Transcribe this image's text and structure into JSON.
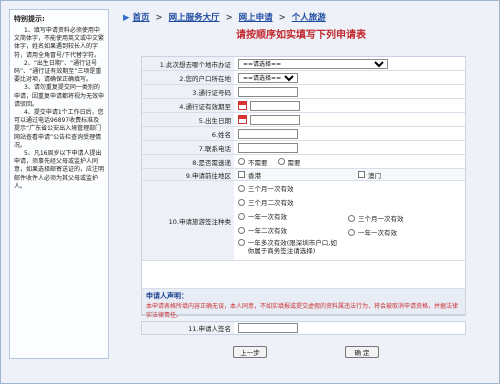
{
  "sidebar": {
    "title": "特别提示:",
    "paragraphs": [
      "1、填写申请资料必须使用中文简体字，不能使用英文或中文繁体字，姓名如果遇到较长人的字符，请用全角冒号/下代替字符。",
      "2、“出生日期”、“通行证号码”、“通行证有效期至”三项是重要比对项，请确保正确填写。",
      "3、请勿重复提交同一类别的申请，因重复申请都将视为无效申请驳回。",
      "4、提交申请1个工作日后，您可以通过电话96897收费标准及提示“广东省公安出入境管理部门网站查看申请”公告栏查询受理情况。",
      "5、凡16周岁以下申请人提出申请，须事先经父母或监护人同意，如果选择邮寄送证的，应注明邮件收件人必须为其父母或监护人。"
    ]
  },
  "breadcrumb": {
    "items": [
      "首页",
      "网上服务大厅",
      "网上申请",
      "个人旅游"
    ],
    "separator": ">"
  },
  "main": {
    "title": "请按顺序如实填写下列申请表"
  },
  "form": {
    "rows": [
      {
        "label": "1.此次想去哪个地市办证",
        "value": "==请选择=="
      },
      {
        "label": "2.您的户口所在地",
        "value": "==请选择=="
      },
      {
        "label": "3.通行证号码",
        "value": ""
      },
      {
        "label": "4.通行证有效期至",
        "value": ""
      },
      {
        "label": "5.出生日期",
        "value": ""
      },
      {
        "label": "6.姓名",
        "value": ""
      },
      {
        "label": "7.联系电话",
        "value": ""
      },
      {
        "label": "8.是否需速递",
        "opts": [
          "不需要",
          "需要"
        ]
      }
    ],
    "destination": {
      "label": "9.申请前往地区",
      "options": [
        "香港",
        "澳门"
      ]
    },
    "endorsement": {
      "label": "10.申请旅游签注种类",
      "left": [
        "三个月一次有效",
        "三个月二次有效",
        "一年一次有效",
        "一年二次有效",
        "一年多次有效(限深圳市户口,如你属于商务签注请选择)"
      ],
      "right": [
        "三个月一次有效",
        "一年一次有效"
      ]
    },
    "notice": {
      "heading": "申请人声明：",
      "text": "本申请表格所填内容正确无误，本人同意，不如实填报或提交虚假的资料属违法行为，将会被取消申请资格，并据法律实法律责任。"
    },
    "signature": {
      "label": "11.申请人签名",
      "value": ""
    }
  },
  "buttons": {
    "prev": "上一步",
    "confirm": "确 定"
  },
  "colors": {
    "title_red": "#c0282d",
    "link_blue": "#1f4aa0"
  }
}
